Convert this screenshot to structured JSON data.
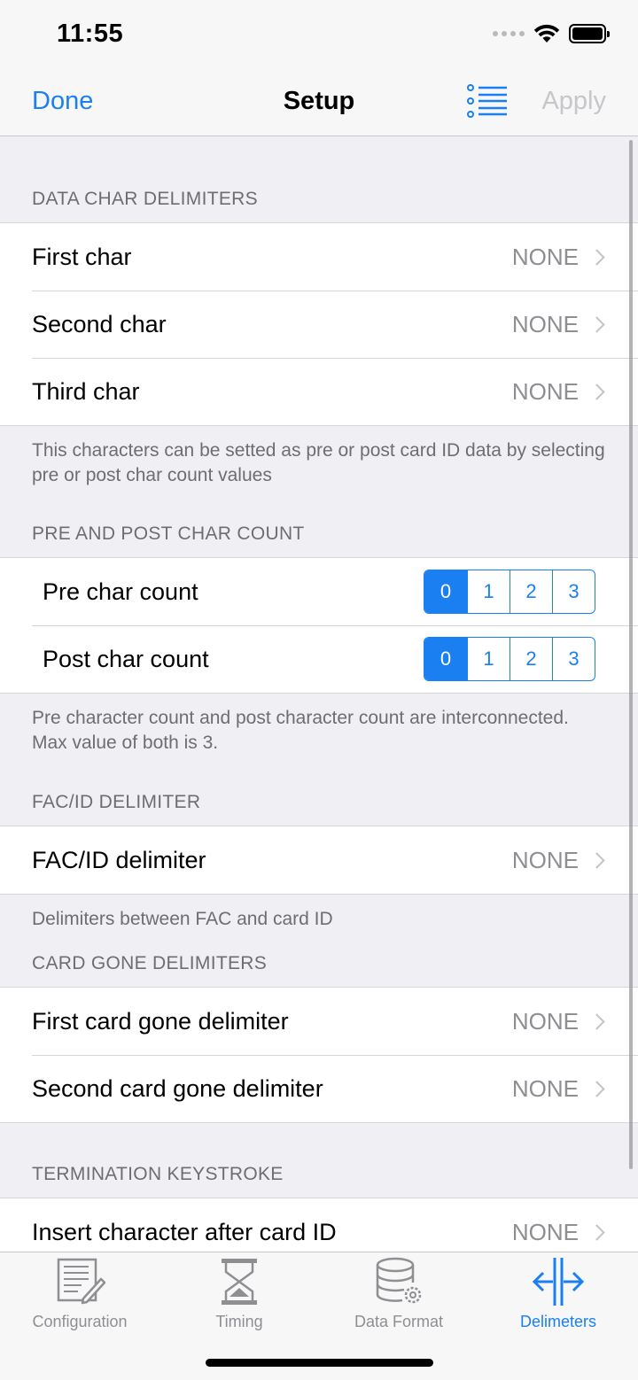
{
  "status": {
    "time": "11:55"
  },
  "nav": {
    "done": "Done",
    "title": "Setup",
    "apply": "Apply"
  },
  "sections": {
    "data_char": {
      "header": "DATA CHAR DELIMITERS",
      "rows": [
        {
          "label": "First char",
          "value": "NONE"
        },
        {
          "label": "Second char",
          "value": "NONE"
        },
        {
          "label": "Third char",
          "value": "NONE"
        }
      ],
      "footer": "This characters can be setted as pre or post card ID data by selecting pre or post char count values"
    },
    "char_count": {
      "header": "PRE AND POST CHAR COUNT",
      "pre_label": "Pre char count",
      "post_label": "Post char count",
      "options": [
        "0",
        "1",
        "2",
        "3"
      ],
      "pre_selected": "0",
      "post_selected": "0",
      "footer": "Pre character count and post character count are interconnected. Max value of both is 3."
    },
    "fac": {
      "header": "FAC/ID DELIMITER",
      "row": {
        "label": "FAC/ID delimiter",
        "value": "NONE"
      },
      "footer": "Delimiters between FAC and card ID"
    },
    "card_gone": {
      "header": "CARD GONE DELIMITERS",
      "rows": [
        {
          "label": "First card gone delimiter",
          "value": "NONE"
        },
        {
          "label": "Second card gone delimiter",
          "value": "NONE"
        }
      ]
    },
    "termination": {
      "header": "TERMINATION KEYSTROKE",
      "row": {
        "label": "Insert character after card ID",
        "value": "NONE"
      }
    }
  },
  "tabs": [
    {
      "label": "Configuration",
      "icon": "document-edit-icon"
    },
    {
      "label": "Timing",
      "icon": "hourglass-icon"
    },
    {
      "label": "Data Format",
      "icon": "database-gear-icon"
    },
    {
      "label": "Delimeters",
      "icon": "delimiter-arrows-icon",
      "active": true
    }
  ],
  "colors": {
    "accent": "#1a7ff0",
    "background": "#efeff4",
    "secondary_text": "#8e8e93"
  }
}
